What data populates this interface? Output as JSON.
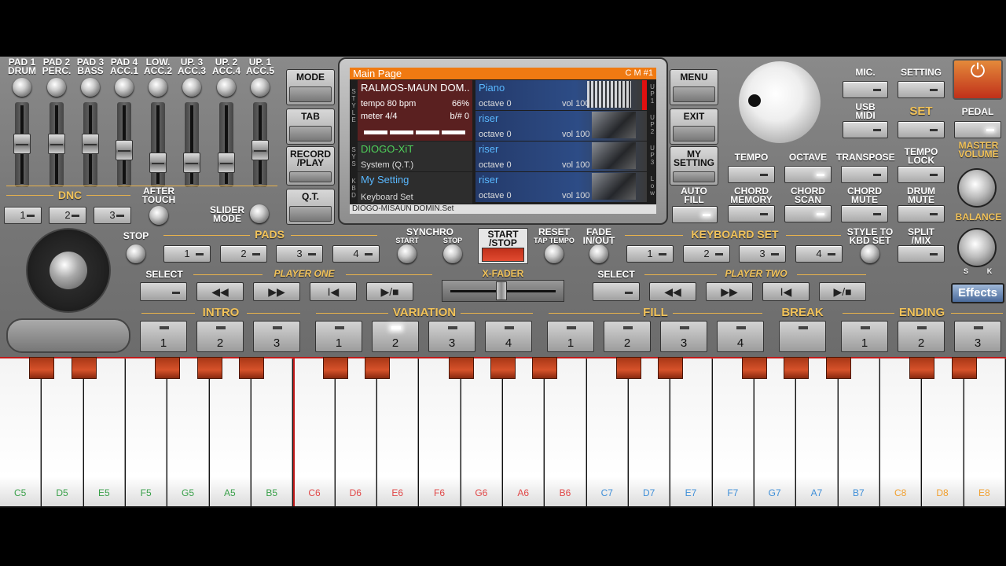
{
  "pads": [
    {
      "l1": "PAD 1",
      "l2": "DRUM"
    },
    {
      "l1": "PAD 2",
      "l2": "PERC."
    },
    {
      "l1": "PAD 3",
      "l2": "BASS"
    },
    {
      "l1": "PAD 4",
      "l2": "ACC.1"
    },
    {
      "l1": "LOW.",
      "l2": "ACC.2"
    },
    {
      "l1": "UP. 3",
      "l2": "ACC.3"
    },
    {
      "l1": "UP. 2",
      "l2": "ACC.4"
    },
    {
      "l1": "UP. 1",
      "l2": "ACC.5"
    }
  ],
  "fader_levels": [
    0.5,
    0.5,
    0.5,
    0.4,
    0.2,
    0.2,
    0.2,
    0.4
  ],
  "dnc": {
    "label": "DNC",
    "buttons": [
      "1",
      "2",
      "3"
    ],
    "after_touch": "AFTER\nTOUCH",
    "slider_mode": "SLIDER\nMODE"
  },
  "left_column": {
    "mode": "MODE",
    "tab": "TAB",
    "record": "RECORD\n/PLAY",
    "qt": "Q.T."
  },
  "right_column": {
    "menu": "MENU",
    "exit": "EXIT",
    "my_setting": "MY\nSETTING",
    "auto_fill": "AUTO\nFILL"
  },
  "screen": {
    "title": "Main Page",
    "cm": "C M #1",
    "style_name": "RALMOS-MAUN DOM..",
    "tempo": "tempo 80 bpm",
    "percent": "66%",
    "meter": "meter 4/4",
    "bsharp": "b/# 0",
    "style_letters": "S T Y L E",
    "sys_name": "DIOGO-XiT",
    "sys_sub": "System (Q.T.)",
    "sys_letters": "S Y S",
    "kbd_name": "My Setting",
    "kbd_sub": "Keyboard Set",
    "kbd_letters": "K B D",
    "up_labels": [
      "U P 1",
      "U P 2",
      "U P 3",
      "L o w"
    ],
    "instruments": [
      {
        "name": "Piano",
        "octave": "octave  0",
        "vol": "vol 100"
      },
      {
        "name": "riser",
        "octave": "octave  0",
        "vol": "vol 100"
      },
      {
        "name": "riser",
        "octave": "octave  0",
        "vol": "vol 100"
      },
      {
        "name": "riser",
        "octave": "octave  0",
        "vol": "vol 100"
      }
    ],
    "footer": "DIOGO-MISAUN DOMIN.Set"
  },
  "top_right": {
    "mic": "MIC.",
    "setting": "SETTING",
    "usb_midi": "USB\nMIDI",
    "set": "SET",
    "pedal": "PEDAL",
    "tempo": "TEMPO",
    "octave": "OCTAVE",
    "transpose": "TRANSPOSE",
    "tempo_lock": "TEMPO\nLOCK",
    "chord_memory": "CHORD\nMEMORY",
    "chord_scan": "CHORD\nSCAN",
    "chord_mute": "CHORD\nMUTE",
    "drum_mute": "DRUM\nMUTE",
    "master_volume": "MASTER\nVOLUME",
    "balance": "BALANCE",
    "balance_s": "S",
    "balance_k": "K"
  },
  "row_controls": {
    "stop": "STOP",
    "pads": "PADS",
    "pad_buttons": [
      "1",
      "2",
      "3",
      "4"
    ],
    "synchro": "SYNCHRO",
    "start": "START",
    "stop_small": "STOP",
    "start_stop": "START\n/STOP",
    "reset": "RESET",
    "tap_tempo": "TAP TEMPO",
    "fade": "FADE\nIN/OUT",
    "keyboard_set": "KEYBOARD SET",
    "kbd_set_buttons": [
      "1",
      "2",
      "3",
      "4"
    ],
    "style_to_kbd": "STYLE TO\nKBD SET",
    "split_mix": "SPLIT\n/MIX"
  },
  "players": {
    "select": "SELECT",
    "player_one": "PLAYER ONE",
    "player_two": "PLAYER TWO",
    "xfader": "X-FADER",
    "transport": [
      "◀◀",
      "▶▶",
      "I◀",
      "▶/■"
    ],
    "effects": "Effects"
  },
  "sections": {
    "intro": "INTRO",
    "variation": "VARIATION",
    "fill": "FILL",
    "break": "BREAK",
    "ending": "ENDING"
  },
  "variation_buttons": [
    {
      "label": "1",
      "on": false
    },
    {
      "label": "2",
      "on": false
    },
    {
      "label": "3",
      "on": false
    },
    {
      "label": "1",
      "on": false
    },
    {
      "label": "2",
      "on": true
    },
    {
      "label": "3",
      "on": false
    },
    {
      "label": "4",
      "on": false
    },
    {
      "label": "1",
      "on": false
    },
    {
      "label": "2",
      "on": false
    },
    {
      "label": "3",
      "on": false
    },
    {
      "label": "4",
      "on": false
    },
    {
      "label": "",
      "on": false
    },
    {
      "label": "1",
      "on": false
    },
    {
      "label": "2",
      "on": false
    },
    {
      "label": "3",
      "on": false
    }
  ],
  "keys": [
    {
      "n": "C5",
      "c": "#3aa04a"
    },
    {
      "n": "D5",
      "c": "#3aa04a"
    },
    {
      "n": "E5",
      "c": "#3aa04a"
    },
    {
      "n": "F5",
      "c": "#3aa04a"
    },
    {
      "n": "G5",
      "c": "#3aa04a"
    },
    {
      "n": "A5",
      "c": "#3aa04a"
    },
    {
      "n": "B5",
      "c": "#3aa04a"
    },
    {
      "n": "C6",
      "c": "#e04848"
    },
    {
      "n": "D6",
      "c": "#e04848"
    },
    {
      "n": "E6",
      "c": "#e04848"
    },
    {
      "n": "F6",
      "c": "#e04848"
    },
    {
      "n": "G6",
      "c": "#e04848"
    },
    {
      "n": "A6",
      "c": "#e04848"
    },
    {
      "n": "B6",
      "c": "#e04848"
    },
    {
      "n": "C7",
      "c": "#3f8fd8"
    },
    {
      "n": "D7",
      "c": "#3f8fd8"
    },
    {
      "n": "E7",
      "c": "#3f8fd8"
    },
    {
      "n": "F7",
      "c": "#3f8fd8"
    },
    {
      "n": "G7",
      "c": "#3f8fd8"
    },
    {
      "n": "A7",
      "c": "#3f8fd8"
    },
    {
      "n": "B7",
      "c": "#3f8fd8"
    },
    {
      "n": "C8",
      "c": "#f0a030"
    },
    {
      "n": "D8",
      "c": "#f0a030"
    },
    {
      "n": "E8",
      "c": "#f0a030"
    }
  ],
  "colors": {
    "accent": "#f07a12",
    "gold": "#f2c35a",
    "power": "#c0301a"
  }
}
